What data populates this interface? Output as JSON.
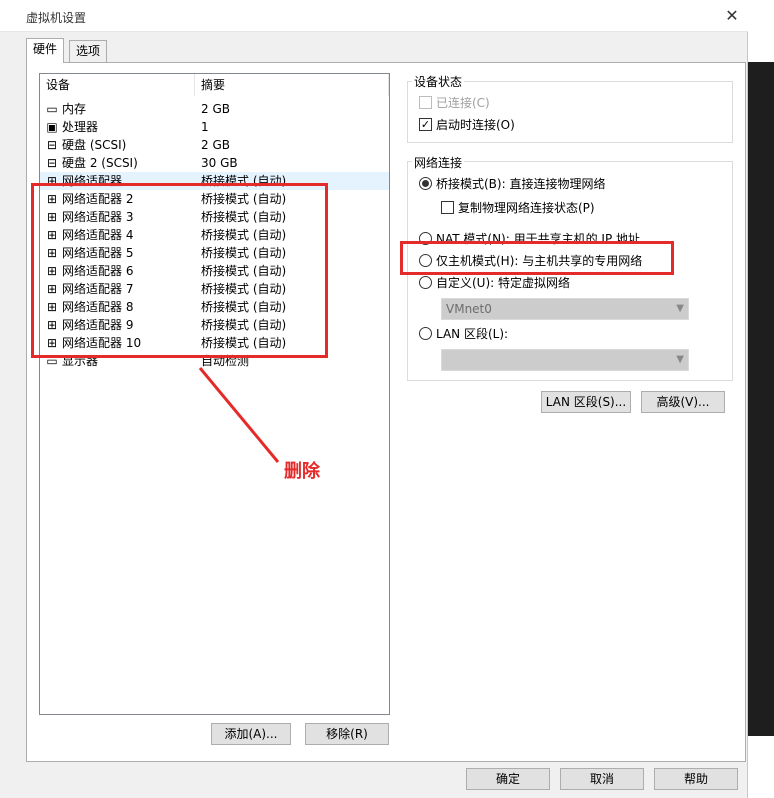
{
  "window": {
    "title": "虚拟机设置"
  },
  "tabs": [
    {
      "label": "硬件"
    },
    {
      "label": "选项"
    }
  ],
  "device_list": {
    "headers": {
      "device": "设备",
      "summary": "摘要"
    },
    "rows": [
      {
        "device": "内存",
        "summary": "2 GB",
        "icon": "memory-icon"
      },
      {
        "device": "处理器",
        "summary": "1",
        "icon": "processor-icon"
      },
      {
        "device": "硬盘 (SCSI)",
        "summary": "2 GB",
        "icon": "hard-disk-icon"
      },
      {
        "device": "硬盘 2 (SCSI)",
        "summary": "30 GB",
        "icon": "hard-disk-icon"
      },
      {
        "device": "网络适配器",
        "summary": "桥接模式 (自动)",
        "icon": "network-adapter-icon"
      },
      {
        "device": "网络适配器 2",
        "summary": "桥接模式 (自动)",
        "icon": "network-adapter-icon"
      },
      {
        "device": "网络适配器 3",
        "summary": "桥接模式 (自动)",
        "icon": "network-adapter-icon"
      },
      {
        "device": "网络适配器 4",
        "summary": "桥接模式 (自动)",
        "icon": "network-adapter-icon"
      },
      {
        "device": "网络适配器 5",
        "summary": "桥接模式 (自动)",
        "icon": "network-adapter-icon"
      },
      {
        "device": "网络适配器 6",
        "summary": "桥接模式 (自动)",
        "icon": "network-adapter-icon"
      },
      {
        "device": "网络适配器 7",
        "summary": "桥接模式 (自动)",
        "icon": "network-adapter-icon"
      },
      {
        "device": "网络适配器 8",
        "summary": "桥接模式 (自动)",
        "icon": "network-adapter-icon"
      },
      {
        "device": "网络适配器 9",
        "summary": "桥接模式 (自动)",
        "icon": "network-adapter-icon"
      },
      {
        "device": "网络适配器 10",
        "summary": "桥接模式 (自动)",
        "icon": "network-adapter-icon"
      },
      {
        "device": "显示器",
        "summary": "自动检测",
        "icon": "display-icon"
      }
    ]
  },
  "list_buttons": {
    "add": "添加(A)...",
    "remove": "移除(R)"
  },
  "device_status": {
    "title": "设备状态",
    "connected": {
      "label": "已连接(C)",
      "checked": false,
      "disabled": true
    },
    "connect_at_power_on": {
      "label": "启动时连接(O)",
      "checked": true
    }
  },
  "network_connection": {
    "title": "网络连接",
    "bridged": {
      "label": "桥接模式(B): 直接连接物理网络",
      "selected": true
    },
    "replicate_state": {
      "label": "复制物理网络连接状态(P)",
      "checked": false
    },
    "nat": {
      "label": "NAT 模式(N): 用于共享主机的 IP 地址",
      "selected": false
    },
    "host_only": {
      "label": "仅主机模式(H): 与主机共享的专用网络",
      "selected": false
    },
    "custom": {
      "label": "自定义(U): 特定虚拟网络",
      "selected": false
    },
    "custom_value": "VMnet0",
    "lan_segment": {
      "label": "LAN 区段(L):",
      "selected": false
    },
    "lan_segment_value": ""
  },
  "right_buttons": {
    "lan_segments": "LAN 区段(S)...",
    "advanced": "高级(V)..."
  },
  "footer": {
    "ok": "确定",
    "cancel": "取消",
    "help": "帮助"
  },
  "annotation": {
    "text": "删除",
    "color": "#e52a2a"
  }
}
